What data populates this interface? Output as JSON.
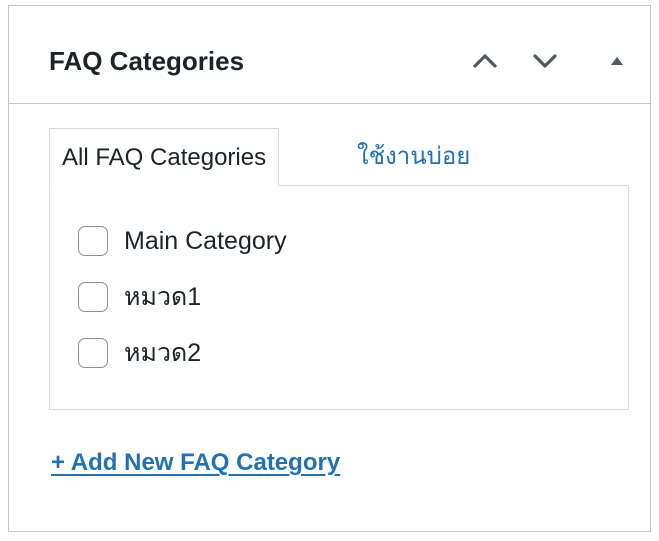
{
  "metabox": {
    "title": "FAQ Categories",
    "buttons": {
      "move_up": "chevron-up-icon",
      "move_down": "chevron-down-icon",
      "toggle": "triangle-up-icon"
    }
  },
  "tabs": {
    "all": "All FAQ Categories",
    "popular": "ใช้งานบ่อย"
  },
  "categories": [
    {
      "label": "Main Category",
      "checked": false
    },
    {
      "label": "หมวด1",
      "checked": false
    },
    {
      "label": "หมวด2",
      "checked": false
    }
  ],
  "add_new_label": "+ Add New FAQ Category",
  "colors": {
    "link": "#2271b1",
    "text": "#1d2327",
    "border": "#c3c4c7",
    "icon": "#50575e"
  }
}
